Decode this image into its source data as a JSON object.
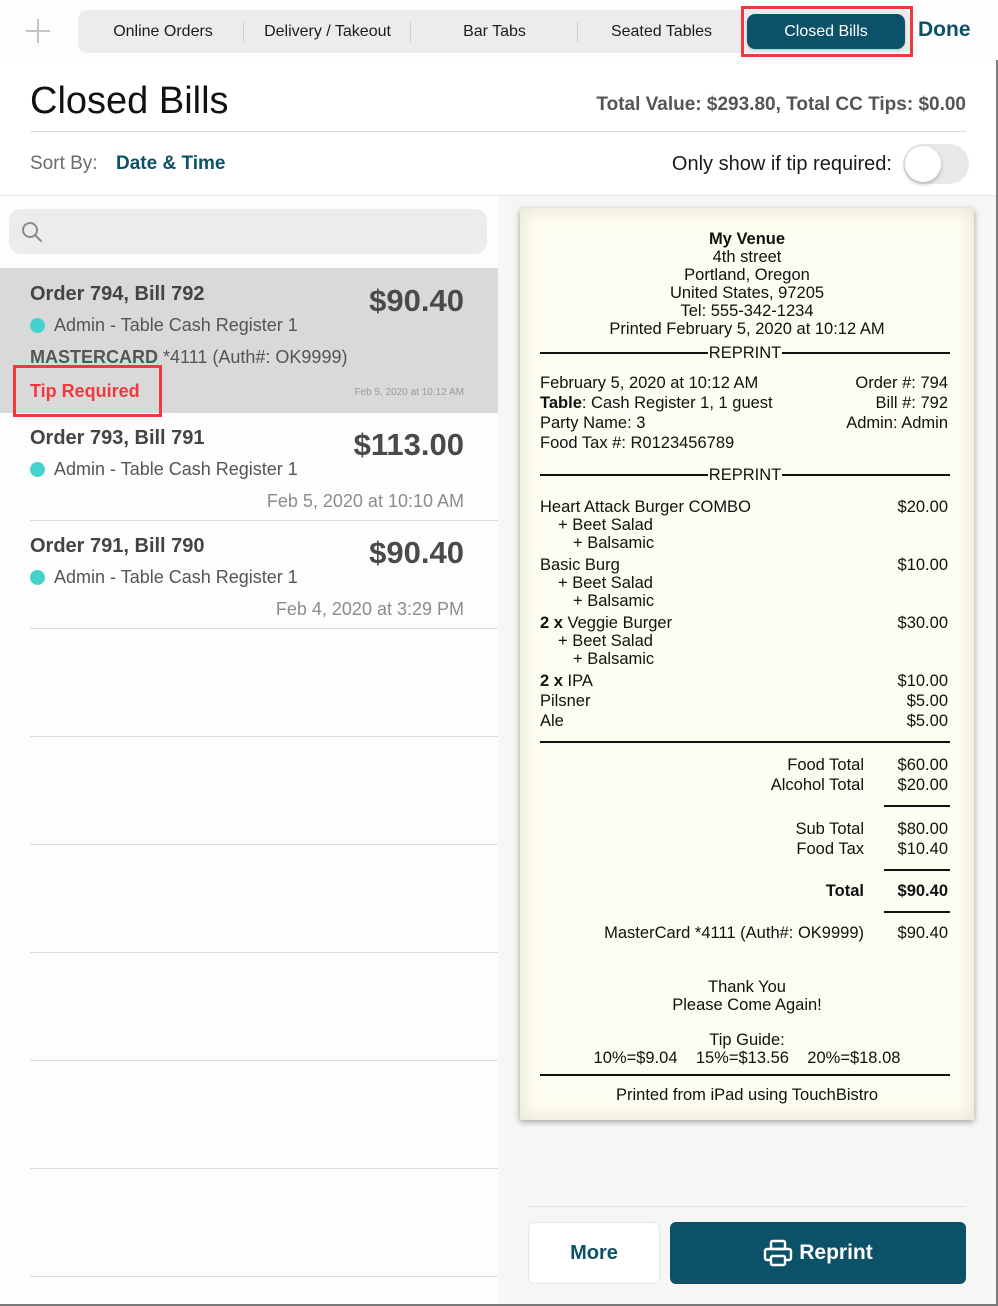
{
  "topbar": {
    "tabs": [
      {
        "label": "Online Orders"
      },
      {
        "label": "Delivery / Takeout"
      },
      {
        "label": "Bar Tabs"
      },
      {
        "label": "Seated Tables"
      },
      {
        "label": "Closed Bills",
        "active": true
      }
    ],
    "done_label": "Done",
    "add_icon": "plus-icon"
  },
  "header": {
    "title": "Closed Bills",
    "totals": "Total Value: $293.80, Total CC Tips: $0.00",
    "sort_label": "Sort By:",
    "sort_value": "Date & Time",
    "tip_filter_label": "Only show if tip required:",
    "tip_filter_on": false
  },
  "search": {
    "placeholder": "",
    "value": "",
    "icon": "search-icon"
  },
  "bills": [
    {
      "title": "Order 794, Bill 792",
      "amount": "$90.40",
      "server": "Admin - Table Cash Register 1",
      "card_brand": "MASTERCARD",
      "card_detail": " *4111 (Auth#: OK9999)",
      "status": "Tip Required",
      "time": "Feb 5, 2020 at 10:12 AM",
      "selected": true
    },
    {
      "title": "Order 793, Bill 791",
      "amount": "$113.00",
      "server": "Admin - Table Cash Register 1",
      "time": "Feb 5, 2020 at 10:10 AM"
    },
    {
      "title": "Order 791, Bill 790",
      "amount": "$90.40",
      "server": "Admin - Table Cash Register 1",
      "time": "Feb 4, 2020 at 3:29 PM"
    }
  ],
  "colors": {
    "accent": "#0b5269",
    "tip_required": "#f0393e",
    "server_dot": "#45d1cc",
    "receipt_bg": "#fdfcf0"
  },
  "receipt": {
    "venue": "My Venue",
    "address": [
      "4th street",
      "Portland, Oregon",
      "United States, 97205",
      "Tel: 555-342-1234"
    ],
    "printed": "Printed February 5, 2020 at 10:12 AM",
    "reprint_label": "REPRINT",
    "datetime": "February 5, 2020 at 10:12 AM",
    "table_label": "Table",
    "table_value": ": Cash Register 1, 1 guest",
    "party": "Party Name: 3",
    "tax_no": "Food Tax #: R0123456789",
    "order_no": "Order #: 794",
    "bill_no": "Bill #: 792",
    "admin": "Admin: Admin",
    "items": [
      {
        "qty": "",
        "name": "Heart Attack Burger COMBO",
        "price": "$20.00",
        "mods": [
          "+ Beet Salad",
          "+ Balsamic"
        ]
      },
      {
        "qty": "",
        "name": "Basic Burg",
        "price": "$10.00",
        "mods": [
          "+ Beet Salad",
          "+ Balsamic"
        ]
      },
      {
        "qty": "2 x",
        "name": " Veggie Burger",
        "price": "$30.00",
        "mods": [
          "+ Beet Salad",
          "+ Balsamic"
        ]
      },
      {
        "qty": "2 x",
        "name": " IPA",
        "price": "$10.00",
        "mods": []
      },
      {
        "qty": "",
        "name": "Pilsner",
        "price": "$5.00",
        "mods": []
      },
      {
        "qty": "",
        "name": "Ale",
        "price": "$5.00",
        "mods": []
      }
    ],
    "food_total_label": "Food Total",
    "food_total": "$60.00",
    "alcohol_total_label": "Alcohol Total",
    "alcohol_total": "$20.00",
    "subtotal_label": "Sub Total",
    "subtotal": "$80.00",
    "food_tax_label": "Food Tax",
    "food_tax": "$10.40",
    "total_label": "Total",
    "total": "$90.40",
    "payment_label": "MasterCard *4111 (Auth#: OK9999)",
    "payment": "$90.40",
    "thanks": [
      "Thank You",
      "Please Come Again!"
    ],
    "tip_guide_label": "Tip Guide:",
    "tip_guide": "10%=$9.04    15%=$13.56    20%=$18.08",
    "footer": "Printed from iPad using TouchBistro"
  },
  "actions": {
    "more_label": "More",
    "reprint_label": "Reprint",
    "reprint_icon": "printer-icon"
  }
}
